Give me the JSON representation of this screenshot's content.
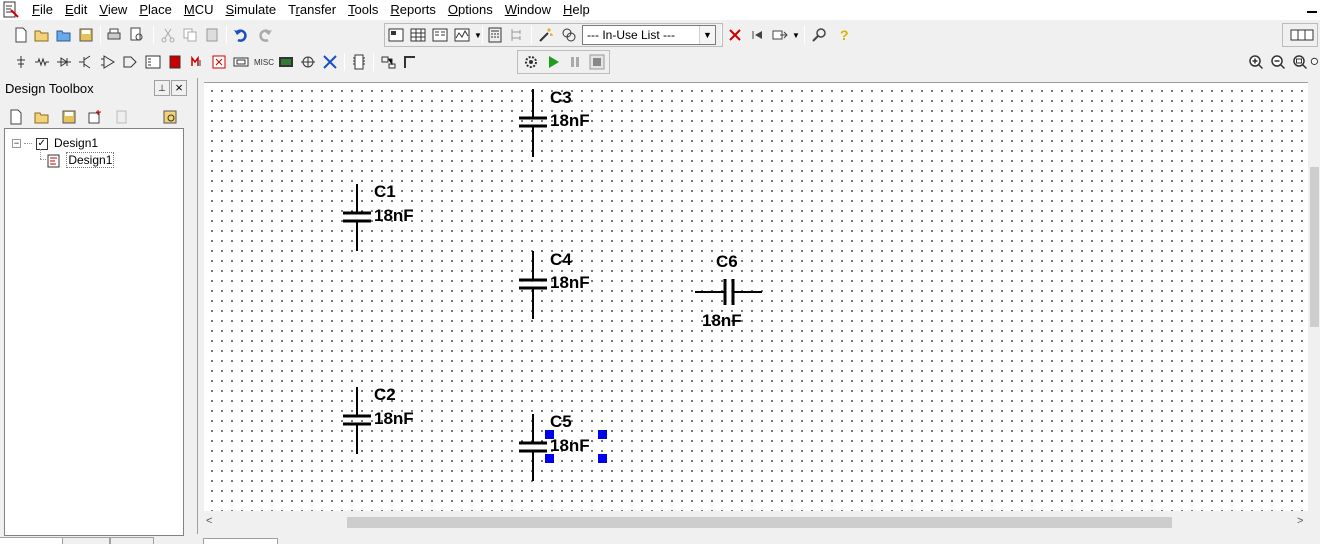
{
  "menubar": {
    "items": [
      {
        "label": "File",
        "accel": "F",
        "rest": "ile"
      },
      {
        "label": "Edit",
        "accel": "E",
        "rest": "dit"
      },
      {
        "label": "View",
        "accel": "V",
        "rest": "iew"
      },
      {
        "label": "Place",
        "accel": "P",
        "rest": "lace"
      },
      {
        "label": "MCU",
        "accel": "M",
        "rest": "CU"
      },
      {
        "label": "Simulate",
        "accel": "S",
        "rest": "imulate"
      },
      {
        "label": "Transfer",
        "pre": "T",
        "accel": "r",
        "rest": "ansfer"
      },
      {
        "label": "Tools",
        "accel": "T",
        "rest": "ools"
      },
      {
        "label": "Reports",
        "accel": "R",
        "rest": "eports"
      },
      {
        "label": "Options",
        "accel": "O",
        "rest": "ptions"
      },
      {
        "label": "Window",
        "accel": "W",
        "rest": "indow"
      },
      {
        "label": "Help",
        "accel": "H",
        "rest": "elp"
      }
    ]
  },
  "toolbar": {
    "in_use_list": "--- In-Use List ---"
  },
  "toolbox": {
    "title": "Design Toolbox",
    "pin_glyph": "⊥",
    "close_glyph": "×",
    "tree": {
      "root": {
        "label": "Design1",
        "expander": "−"
      },
      "child": {
        "label": "Design1"
      }
    }
  },
  "schematic": {
    "components": [
      {
        "ref": "C3",
        "value": "18nF",
        "orientation": "vertical"
      },
      {
        "ref": "C1",
        "value": "18nF",
        "orientation": "vertical"
      },
      {
        "ref": "C4",
        "value": "18nF",
        "orientation": "vertical"
      },
      {
        "ref": "C6",
        "value": "18nF",
        "orientation": "horizontal"
      },
      {
        "ref": "C2",
        "value": "18nF",
        "orientation": "vertical"
      },
      {
        "ref": "C5",
        "value": "18nF",
        "orientation": "vertical",
        "selected": true
      }
    ],
    "selection_color": "#0000e6"
  },
  "scroll": {
    "left_arrow": "<",
    "right_arrow": ">"
  }
}
